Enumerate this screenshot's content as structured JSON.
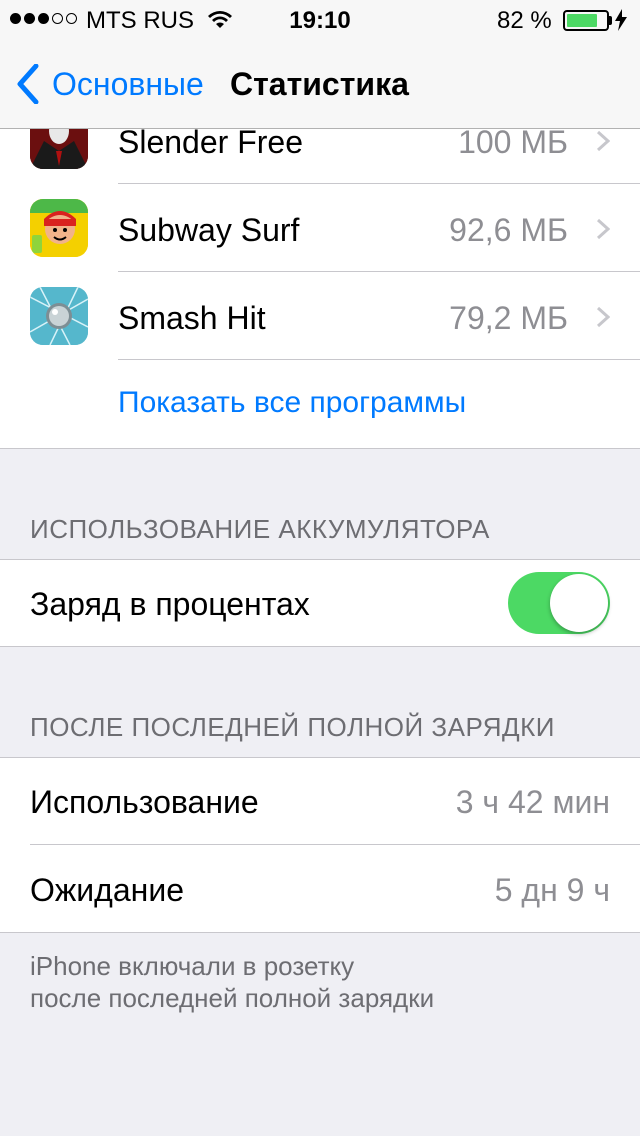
{
  "status_bar": {
    "carrier": "MTS RUS",
    "time": "19:10",
    "battery_percent": "82 %",
    "battery_level": 0.82,
    "signal_bars": [
      true,
      true,
      true,
      false,
      false
    ]
  },
  "nav": {
    "back_label": "Основные",
    "title": "Статистика"
  },
  "apps": [
    {
      "name": "Slender Free",
      "size": "100 МБ",
      "icon": "slender-app-icon"
    },
    {
      "name": "Subway Surf",
      "size": "92,6 МБ",
      "icon": "subway-surf-app-icon"
    },
    {
      "name": "Smash Hit",
      "size": "79,2 МБ",
      "icon": "smash-hit-app-icon"
    }
  ],
  "show_all_label": "Показать все программы",
  "battery_usage": {
    "header": "ИСПОЛЬЗОВАНИЕ АККУМУЛЯТОРА",
    "percent_label": "Заряд в процентах",
    "percent_on": true
  },
  "since_charge": {
    "header": "ПОСЛЕ ПОСЛЕДНЕЙ ПОЛНОЙ ЗАРЯДКИ",
    "usage_label": "Использование",
    "usage_value": "3 ч 42 мин",
    "standby_label": "Ожидание",
    "standby_value": "5 дн 9 ч",
    "footer_line1": "iPhone включали в розетку",
    "footer_line2": "после последней полной зарядки"
  },
  "colors": {
    "accent": "#007aff",
    "toggle_on": "#4cd964",
    "background": "#efeff4"
  }
}
